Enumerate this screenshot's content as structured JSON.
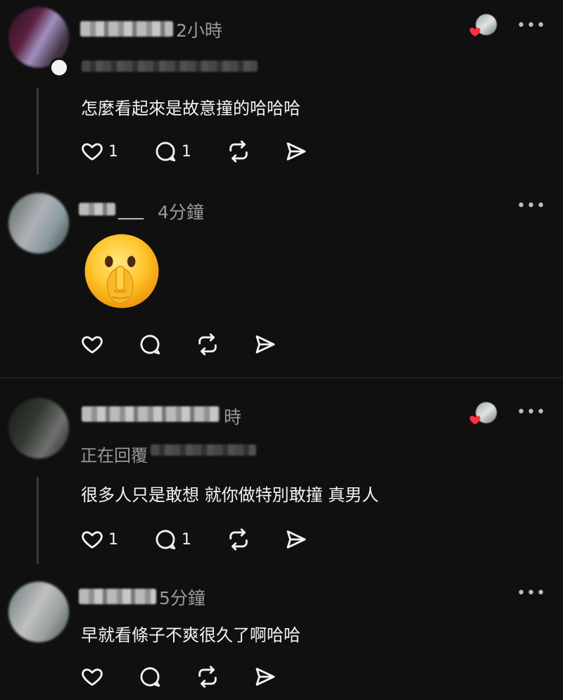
{
  "comments": [
    {
      "time": "2小時",
      "text": "怎麼看起來是故意撞的哈哈哈",
      "like_count": "1",
      "reply_count": "1",
      "more": "•••"
    },
    {
      "name_suffix": "___",
      "time": "4分鐘",
      "emoji": "shushing-face",
      "more": "•••"
    },
    {
      "time": "時",
      "reply_label": "正在回覆",
      "text": "很多人只是敢想 就你做特別敢撞 真男人",
      "like_count": "1",
      "reply_count": "1",
      "more": "•••"
    },
    {
      "time": "5分鐘",
      "text": "早就看條子不爽很久了啊哈哈",
      "more": "•••"
    }
  ],
  "colors": {
    "background": "#101010",
    "text": "#f3f3f3",
    "muted": "#9a9a9a",
    "heart": "#ff3040"
  },
  "icons": [
    "heart-icon",
    "comment-icon",
    "repost-icon",
    "share-icon",
    "more-icon"
  ]
}
